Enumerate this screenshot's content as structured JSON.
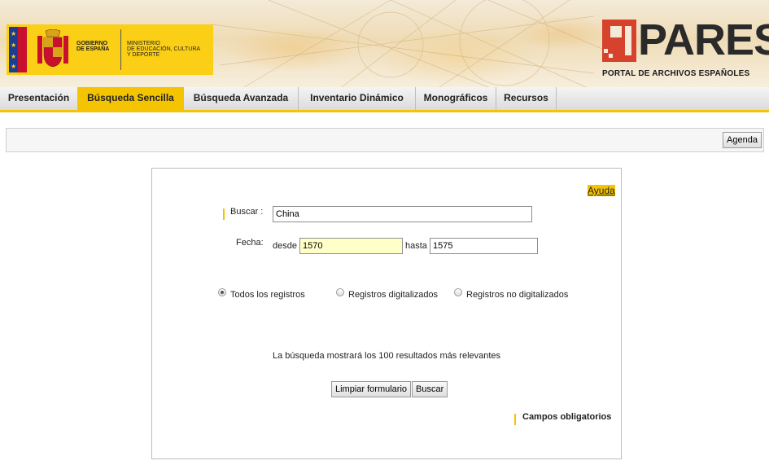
{
  "header": {
    "gov_line1": "GOBIERNO",
    "gov_line2": "DE ESPAÑA",
    "ministry_line1": "MINISTERIO",
    "ministry_line2": "DE EDUCACIÓN, CULTURA",
    "ministry_line3": "Y DEPORTE",
    "brand": "PARES",
    "brand_subtitle": "PORTAL DE ARCHIVOS ESPAÑOLES"
  },
  "nav": {
    "items": [
      {
        "label": "Presentación"
      },
      {
        "label": "Búsqueda Sencilla"
      },
      {
        "label": "Búsqueda Avanzada"
      },
      {
        "label": "Inventario Dinámico"
      },
      {
        "label": "Monográficos"
      },
      {
        "label": "Recursos"
      }
    ],
    "active_index": 1
  },
  "toolbar": {
    "agenda_label": "Agenda"
  },
  "form": {
    "help_link": "Ayuda",
    "search_label": "Buscar :",
    "search_value": "China",
    "date_label": "Fecha:",
    "from_label": "desde",
    "from_value": "1570",
    "to_label": "hasta",
    "to_value": "1575",
    "radios": [
      {
        "label": "Todos los registros",
        "checked": true
      },
      {
        "label": "Registros digitalizados",
        "checked": false
      },
      {
        "label": "Registros no digitalizados",
        "checked": false
      }
    ],
    "info_text": "La búsqueda mostrará los 100 resultados más relevantes",
    "clear_button": "Limpiar formulario",
    "search_button": "Buscar",
    "required_note": "Campos obligatorios"
  },
  "colors": {
    "accent": "#f5c400",
    "brand_red": "#d6422b",
    "gov_yellow": "#fbcf15"
  }
}
